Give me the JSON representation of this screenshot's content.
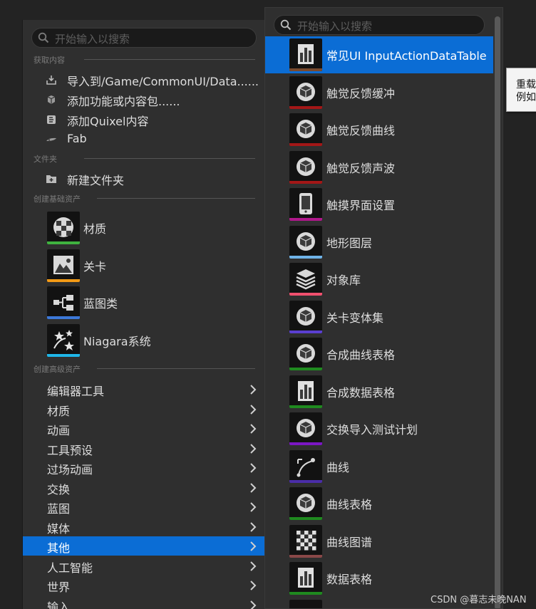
{
  "left_menu": {
    "search_placeholder": "开始输入以搜索",
    "sections": {
      "get_content": "获取内容",
      "folder": "文件夹",
      "basic_assets": "创建基础资产",
      "advanced_assets": "创建高级资产"
    },
    "get_content_items": [
      {
        "label": "导入到/Game/CommonUI/Data......",
        "icon": "import-icon"
      },
      {
        "label": "添加功能或内容包......",
        "icon": "add-feature-pack-icon"
      },
      {
        "label": "添加Quixel内容",
        "icon": "quixel-icon"
      },
      {
        "label": "Fab",
        "icon": "fab-icon"
      }
    ],
    "folder_items": [
      {
        "label": "新建文件夹",
        "icon": "new-folder-icon"
      }
    ],
    "basic_items": [
      {
        "label": "材质",
        "icon": "material-icon",
        "color": "#3fb23f"
      },
      {
        "label": "关卡",
        "icon": "level-icon",
        "color": "#f29a16"
      },
      {
        "label": "蓝图类",
        "icon": "blueprint-class-icon",
        "color": "#3c78d8"
      },
      {
        "label": "Niagara系统",
        "icon": "niagara-system-icon",
        "color": "#1fb6e8"
      }
    ],
    "advanced_items": [
      {
        "label": "编辑器工具"
      },
      {
        "label": "材质"
      },
      {
        "label": "动画"
      },
      {
        "label": "工具预设"
      },
      {
        "label": "过场动画"
      },
      {
        "label": "交换"
      },
      {
        "label": "蓝图"
      },
      {
        "label": "媒体"
      },
      {
        "label": "其他",
        "active": true
      },
      {
        "label": "人工智能"
      },
      {
        "label": "世界"
      },
      {
        "label": "输入"
      }
    ]
  },
  "right_menu": {
    "search_placeholder": "开始输入以搜索",
    "items": [
      {
        "label": "常见UI InputActionDataTable",
        "icon": "data-table-icon",
        "color": "#7a4a2e",
        "active": true
      },
      {
        "label": "触觉反馈缓冲",
        "icon": "haptic-feedback-buffer-icon",
        "color": "#a31717"
      },
      {
        "label": "触觉反馈曲线",
        "icon": "haptic-feedback-curve-icon",
        "color": "#a31717"
      },
      {
        "label": "触觉反馈声波",
        "icon": "haptic-feedback-soundwave-icon",
        "color": "#a31717"
      },
      {
        "label": "触摸界面设置",
        "icon": "touch-interface-icon",
        "color": "#b0188b"
      },
      {
        "label": "地形图层",
        "icon": "landscape-layer-icon",
        "color": "#6fb3e8"
      },
      {
        "label": "对象库",
        "icon": "object-library-icon",
        "color": "#f0506e"
      },
      {
        "label": "关卡变体集",
        "icon": "level-variant-sets-icon",
        "color": "#5a3fd0"
      },
      {
        "label": "合成曲线表格",
        "icon": "composite-curve-table-icon",
        "color": "#1f8a1f"
      },
      {
        "label": "合成数据表格",
        "icon": "composite-data-table-icon",
        "color": "#1f8a1f"
      },
      {
        "label": "交换导入测试计划",
        "icon": "interchange-test-plan-icon",
        "color": "#7b17c4"
      },
      {
        "label": "曲线",
        "icon": "curve-icon",
        "color": "#4a2da8"
      },
      {
        "label": "曲线表格",
        "icon": "curve-table-icon",
        "color": "#1f8a1f"
      },
      {
        "label": "曲线图谱",
        "icon": "curve-atlas-icon",
        "color": "#8a4848"
      },
      {
        "label": "数据表格",
        "icon": "data-table-icon",
        "color": "#1f8a1f"
      },
      {
        "label": "",
        "icon": "asset-icon",
        "color": "#5a5a5a"
      }
    ]
  },
  "tooltip": {
    "line1": "重载",
    "line2": "例如"
  },
  "watermark": "CSDN @暮志未晚NAN"
}
